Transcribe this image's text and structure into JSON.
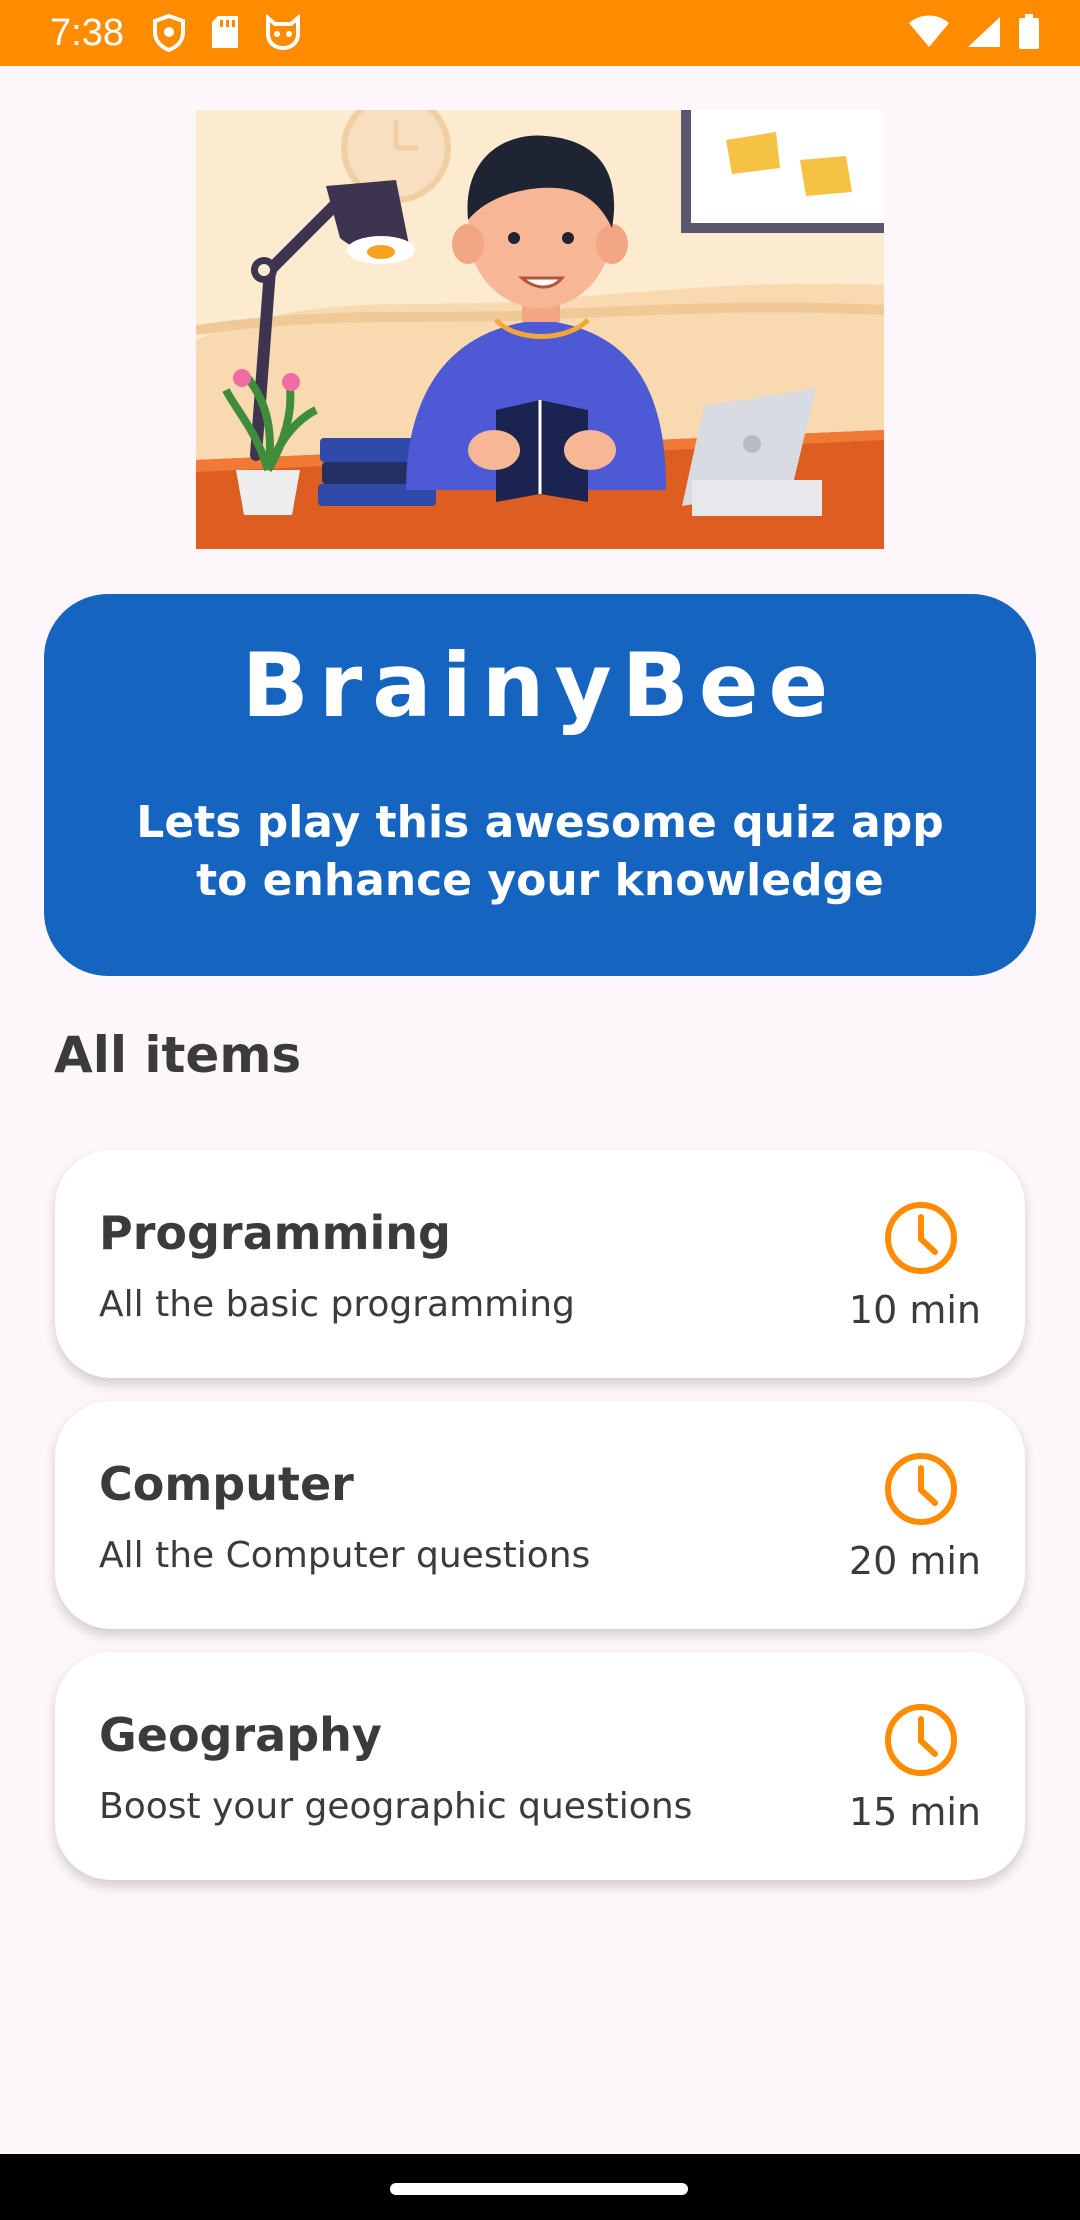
{
  "status_bar": {
    "time": "7:38",
    "background": "#fe8b00",
    "icons_left": [
      "shield-icon",
      "sd-card-icon",
      "cat-face-icon"
    ],
    "icons_right": [
      "wifi-icon",
      "cellular-signal-icon",
      "battery-icon"
    ]
  },
  "hero": {
    "icon": "student-studying-illustration"
  },
  "banner": {
    "title": "BrainyBee",
    "subtitle": "Lets play this awesome quiz app to enhance your knowledge",
    "background": "#1565c0"
  },
  "section": {
    "title": "All items"
  },
  "quiz_items": [
    {
      "title": "Programming",
      "description": "All the basic programming",
      "duration": "10 min",
      "icon": "clock-icon"
    },
    {
      "title": "Computer",
      "description": "All the Computer questions",
      "duration": "20 min",
      "icon": "clock-icon"
    },
    {
      "title": "Geography",
      "description": "Boost your geographic questions",
      "duration": "15 min",
      "icon": "clock-icon"
    }
  ],
  "colors": {
    "accent": "#fe8b00",
    "brand": "#1565c0",
    "background": "#fdf7fb",
    "card": "#ffffff",
    "text": "#3b3b3b"
  }
}
